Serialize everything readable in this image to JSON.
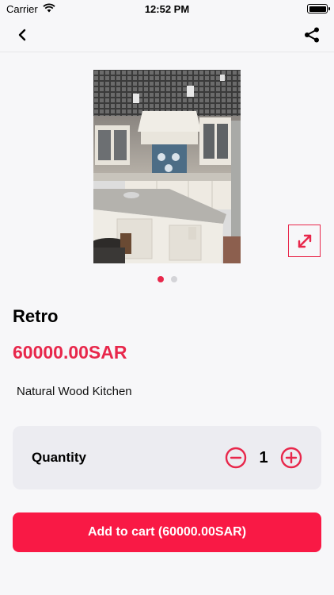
{
  "status_bar": {
    "carrier": "Carrier",
    "time": "12:52 PM"
  },
  "nav": {
    "back_icon": "chevron-left-icon",
    "share_icon": "share-icon"
  },
  "gallery": {
    "image_alt": "kitchen-photo",
    "expand_icon": "expand-icon",
    "page_count": 2,
    "active_index": 0
  },
  "product": {
    "title": "Retro",
    "price": "60000.00SAR",
    "description": "Natural Wood Kitchen"
  },
  "quantity": {
    "label": "Quantity",
    "value": "1",
    "minus_icon": "minus-circle-icon",
    "plus_icon": "plus-circle-icon"
  },
  "cart": {
    "button_label": "Add to cart (60000.00SAR)"
  },
  "colors": {
    "accent": "#e8274b",
    "button": "#f91945",
    "background": "#f7f7f9",
    "card": "#ececf1"
  }
}
